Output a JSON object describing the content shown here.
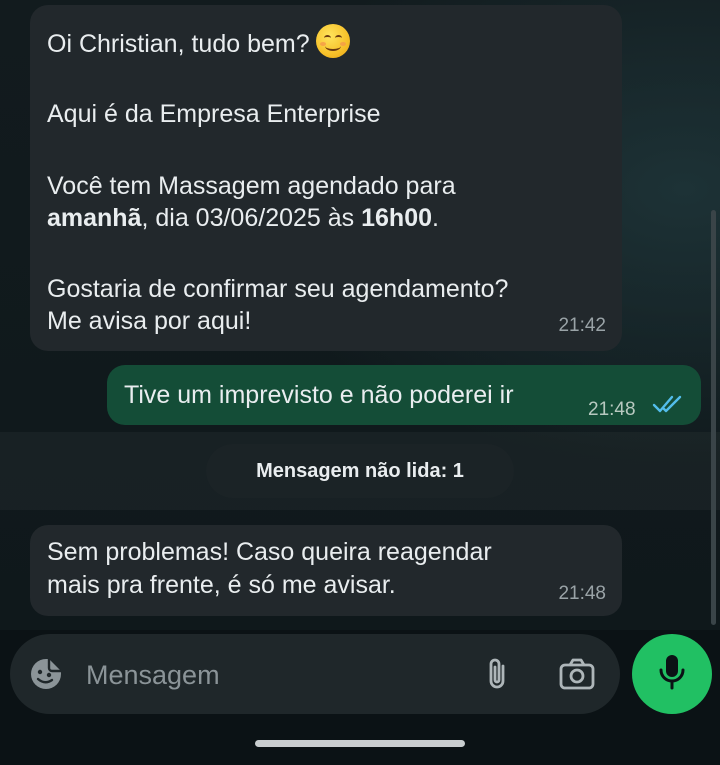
{
  "messages": {
    "first": {
      "greeting": "Oi Christian, tudo bem?",
      "emoji": "smiling-face-icon",
      "line_company": "Aqui é da Empresa Enterprise",
      "line_schedule_1": "Você tem Massagem agendado para",
      "line_schedule_bold_day": "amanhã",
      "line_schedule_middle": ", dia 03/06/2025 às ",
      "line_schedule_bold_time": "16h00",
      "line_schedule_end": ".",
      "line_confirm": "Gostaria de confirmar seu agendamento?",
      "line_ask": "Me avisa por aqui!",
      "time": "21:42"
    },
    "reply": {
      "text": "Tive um imprevisto e não poderei ir",
      "time": "21:48",
      "status": "read"
    },
    "unread_divider": "Mensagem não lida: 1",
    "third": {
      "line_1": "Sem problemas! Caso queira reagendar",
      "line_2": "mais pra frente, é só me avisar.",
      "time": "21:48"
    }
  },
  "composer": {
    "placeholder": "Mensagem",
    "icons": [
      "sticker-icon",
      "paperclip-icon",
      "camera-icon",
      "microphone-icon"
    ]
  },
  "colors": {
    "incoming_bubble": "#22282c",
    "outgoing_bubble": "#144d37",
    "read_ticks": "#53bdeb",
    "mic_button": "#21c063"
  }
}
